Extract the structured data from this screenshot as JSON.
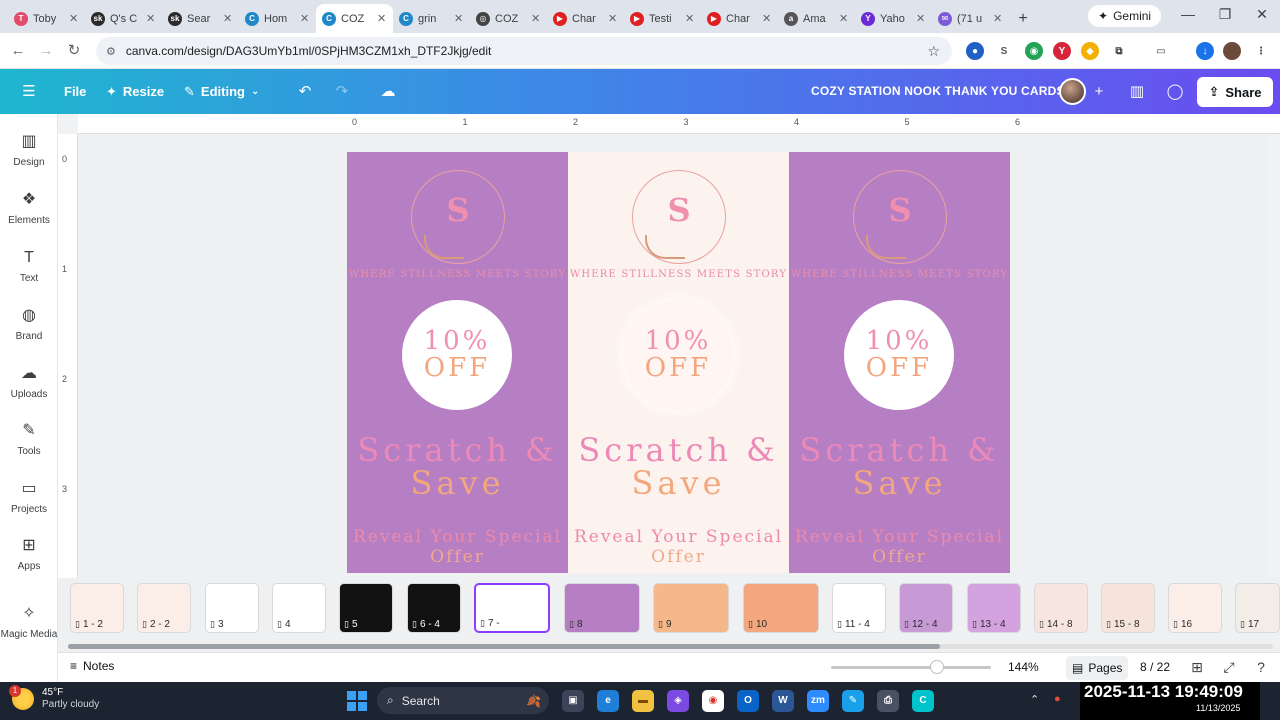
{
  "browser": {
    "tabs": [
      {
        "title": "Toby",
        "fav_color": "#e34b6b",
        "fav_glyph": "T"
      },
      {
        "title": "Q's C",
        "fav_color": "#2b2b2b",
        "fav_glyph": "sk"
      },
      {
        "title": "Sear",
        "fav_color": "#2b2b2b",
        "fav_glyph": "sk"
      },
      {
        "title": "Hom",
        "fav_color": "#1e88c9",
        "fav_glyph": "C"
      },
      {
        "title": "COZ",
        "fav_color": "#1e88c9",
        "fav_glyph": "C",
        "active": true
      },
      {
        "title": "grin",
        "fav_color": "#1e88c9",
        "fav_glyph": "C"
      },
      {
        "title": "COZ",
        "fav_color": "#444444",
        "fav_glyph": "◎"
      },
      {
        "title": "Char",
        "fav_color": "#e02020",
        "fav_glyph": "▶"
      },
      {
        "title": "Testi",
        "fav_color": "#e02020",
        "fav_glyph": "▶"
      },
      {
        "title": "Char",
        "fav_color": "#e02020",
        "fav_glyph": "▶"
      },
      {
        "title": "Ama",
        "fav_color": "#555555",
        "fav_glyph": "a"
      },
      {
        "title": "Yaho",
        "fav_color": "#6a2bd6",
        "fav_glyph": "Y"
      },
      {
        "title": "(71 u",
        "fav_color": "#7b5cd6",
        "fav_glyph": "✉"
      }
    ],
    "new_tab": "+",
    "gemini_label": "Gemini",
    "url": "canva.com/design/DAG3UmYb1ml/0SPjHM3CZM1xh_DTF2Jkjg/edit"
  },
  "canva_header": {
    "menu_icon": "hamburger-icon",
    "file_label": "File",
    "resize_label": "Resize",
    "editing_label": "Editing",
    "doc_title": "COZY STATION NOOK THANK YOU CARDS",
    "share_label": "Share"
  },
  "sidebar": {
    "items": [
      {
        "label": "Design",
        "icon": "▥"
      },
      {
        "label": "Elements",
        "icon": "❖"
      },
      {
        "label": "Text",
        "icon": "T"
      },
      {
        "label": "Brand",
        "icon": "◍"
      },
      {
        "label": "Uploads",
        "icon": "☁"
      },
      {
        "label": "Tools",
        "icon": "✎"
      },
      {
        "label": "Projects",
        "icon": "▭"
      },
      {
        "label": "Apps",
        "icon": "⊞"
      },
      {
        "label": "Magic Media",
        "icon": "✧"
      }
    ]
  },
  "ruler": {
    "top_ticks": [
      "0",
      "1",
      "2",
      "3",
      "4",
      "5",
      "6"
    ],
    "left_ticks": [
      "0",
      "1",
      "2",
      "3"
    ]
  },
  "cards": [
    {
      "variant": "purple",
      "logo_letter": "S",
      "tagline": "WHERE STILLNESS MEETS STORY",
      "discount_line1": "10%",
      "discount_line2": "OFF",
      "headline_line1": "Scratch &",
      "headline_line2": "Save",
      "reveal_line1": "Reveal Your Special",
      "reveal_line2": "Offer"
    },
    {
      "variant": "cream",
      "logo_letter": "S",
      "tagline": "WHERE STILLNESS MEETS STORY",
      "discount_line1": "10%",
      "discount_line2": "OFF",
      "headline_line1": "Scratch &",
      "headline_line2": "Save",
      "reveal_line1": "Reveal Your Special",
      "reveal_line2": "Offer"
    },
    {
      "variant": "purple",
      "logo_letter": "S",
      "tagline": "WHERE STILLNESS MEETS STORY",
      "discount_line1": "10%",
      "discount_line2": "OFF",
      "headline_line1": "Scratch &",
      "headline_line2": "Save",
      "reveal_line1": "Reveal Your Special",
      "reveal_line2": "Offer"
    }
  ],
  "pages": {
    "thumbs": [
      {
        "label": "1 - 2",
        "bg": "#fbeee9"
      },
      {
        "label": "2 - 2",
        "bg": "#fbeee9"
      },
      {
        "label": "3",
        "bg": "#ffffff"
      },
      {
        "label": "4",
        "bg": "#ffffff"
      },
      {
        "label": "5",
        "bg": "#111111"
      },
      {
        "label": "6 - 4",
        "bg": "#111111"
      },
      {
        "label": "7 -",
        "bg": "#ffffff",
        "selected": true
      },
      {
        "label": "8",
        "bg": "#b67fc4"
      },
      {
        "label": "9",
        "bg": "#f6b88a"
      },
      {
        "label": "10",
        "bg": "#f4a77e"
      },
      {
        "label": "11 - 4",
        "bg": "#ffffff"
      },
      {
        "label": "12 - 4",
        "bg": "#c79ad6"
      },
      {
        "label": "13 - 4",
        "bg": "#d5a2e0"
      },
      {
        "label": "14 - 8",
        "bg": "#f7e6e0"
      },
      {
        "label": "15 - 8",
        "bg": "#f6e4dc"
      },
      {
        "label": "16",
        "bg": "#fbeee9"
      },
      {
        "label": "17",
        "bg": "#f3ede7"
      }
    ]
  },
  "bottombar": {
    "notes_label": "Notes",
    "zoom": "144%",
    "pages_label": "Pages",
    "page_count": "8 / 22"
  },
  "taskbar": {
    "temp": "45°F",
    "weather": "Partly cloudy",
    "weather_badge": "1",
    "search_label": "Search",
    "clock_big": "2025-11-13  19:49:09",
    "clock_small": "11/13/2025"
  }
}
